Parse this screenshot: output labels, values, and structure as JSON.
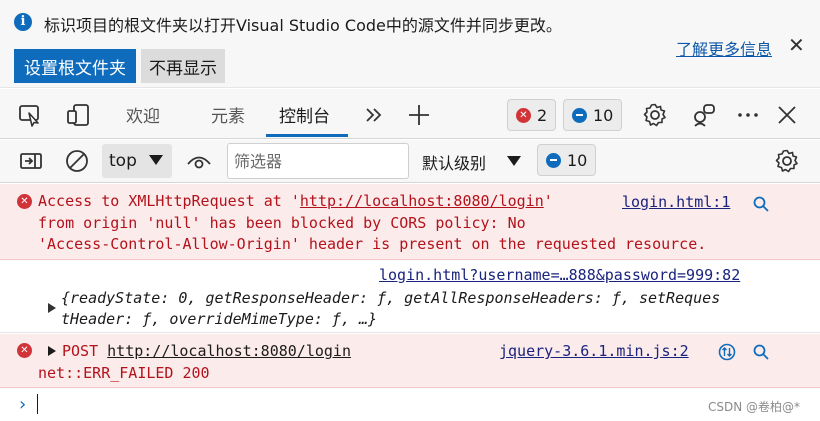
{
  "infobar": {
    "message": "标识项目的根文件夹以打开Visual Studio Code中的源文件并同步更改。",
    "set_root_label": "设置根文件夹",
    "dont_show_label": "不再显示",
    "learn_more_label": "了解更多信息"
  },
  "tabs": [
    {
      "label": "欢迎"
    },
    {
      "label": "元素"
    },
    {
      "label": "控制台"
    }
  ],
  "toolbar": {
    "error_count": "2",
    "message_count": "10"
  },
  "console_toolbar": {
    "context": "top",
    "filter_placeholder": "筛选器",
    "level": "默认级别",
    "message_count": "10"
  },
  "messages": {
    "cors_error": {
      "line1_pre": "Access to XMLHttpRequest at '",
      "line1_url": "http://localhost:8080/login",
      "line1_post": "'",
      "line2": "from origin 'null' has been blocked by CORS policy: No",
      "line3": "'Access-Control-Allow-Origin' header is present on the requested resource.",
      "source": "login.html:1"
    },
    "log": {
      "source": "login.html?username=…888&password=999:82",
      "obj_line1": "{readyState: 0, getResponseHeader: ƒ, getAllResponseHeaders: ƒ, setReques",
      "obj_line2": "tHeader: ƒ, overrideMimeType: ƒ, …}"
    },
    "post_error": {
      "method": "POST",
      "url": "http://localhost:8080/login",
      "status": "net::ERR_FAILED 200",
      "source": "jquery-3.6.1.min.js:2"
    }
  },
  "watermark": "CSDN @卷柏@*",
  "colors": {
    "accent": "#0f6cbd",
    "error_bg": "#fcebeb",
    "error_text": "#b4121b"
  }
}
